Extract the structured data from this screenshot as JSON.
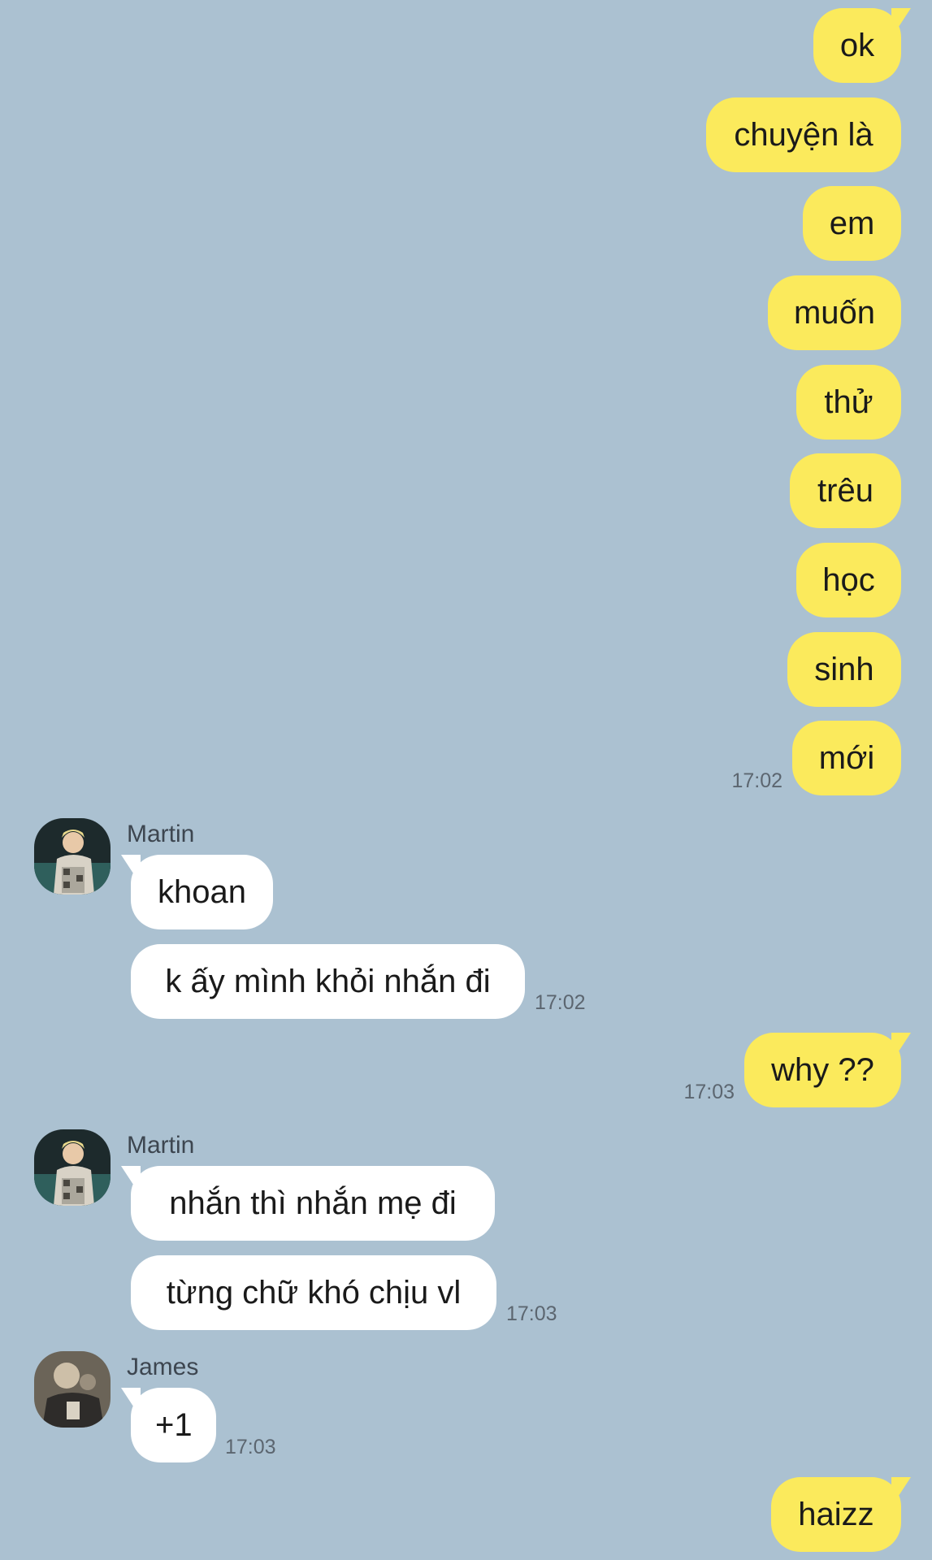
{
  "messages_out_1": [
    "ok",
    "chuyện là",
    "em",
    "muốn",
    "thử",
    "trêu",
    "học",
    "sinh",
    "mới"
  ],
  "time_out_1": "17:02",
  "martin_1": {
    "name": "Martin",
    "messages": [
      "khoan",
      "k ấy mình khỏi nhắn đi"
    ],
    "time": "17:02"
  },
  "out_2": {
    "text": "why ??",
    "time": "17:03"
  },
  "martin_2": {
    "name": "Martin",
    "messages": [
      "nhắn thì nhắn mẹ đi",
      "từng chữ khó chịu vl"
    ],
    "time": "17:03"
  },
  "james": {
    "name": "James",
    "messages": [
      "+1"
    ],
    "time": "17:03"
  },
  "out_3": {
    "text": "haizz"
  },
  "colors": {
    "background": "#abc1d1",
    "outgoing_bubble": "#fbea5c",
    "incoming_bubble": "#ffffff"
  }
}
